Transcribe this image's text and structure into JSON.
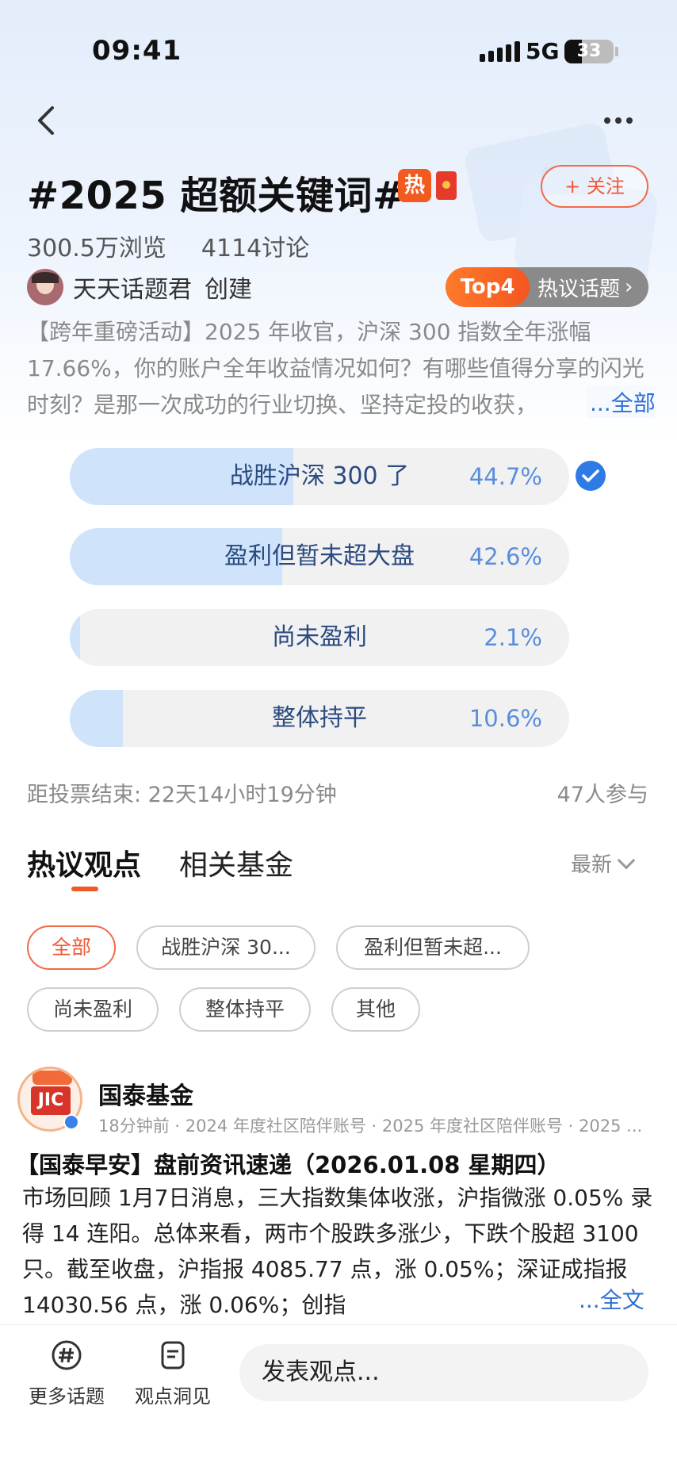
{
  "status_bar": {
    "time": "09:41",
    "network": "5G",
    "battery": "33"
  },
  "topic": {
    "title": "#2025 超额关键词#",
    "hot_badge": "热",
    "follow_label": "+ 关注",
    "views": "300.5万浏览",
    "discussions": "4114讨论",
    "creator_name": "天天话题君",
    "creator_action": "创建",
    "rank_label": "Top4",
    "rank_text": "热议话题",
    "rank_chevron": "›",
    "description": "【跨年重磅活动】2025 年收官，沪深 300 指数全年涨幅 17.66%，你的账户全年收益情况如何？有哪些值得分享的闪光时刻？是那一次成功的行业切换、坚持定投的收获，",
    "description_more": "...全部"
  },
  "poll": {
    "options": [
      {
        "label": "战胜沪深 300 了",
        "percent": "44.7%",
        "fill": 0.447,
        "selected": true
      },
      {
        "label": "盈利但暂未超大盘",
        "percent": "42.6%",
        "fill": 0.426,
        "selected": false
      },
      {
        "label": "尚未盈利",
        "percent": "2.1%",
        "fill": 0.021,
        "selected": false
      },
      {
        "label": "整体持平",
        "percent": "10.6%",
        "fill": 0.106,
        "selected": false
      }
    ],
    "countdown": "距投票结束:  22天14小时19分钟",
    "participants": "47人参与"
  },
  "tabs": {
    "active": "热议观点",
    "other": "相关基金",
    "sort": "最新"
  },
  "filters": [
    "全部",
    "战胜沪深 30...",
    "盈利但暂未超...",
    "尚未盈利",
    "整体持平",
    "其他"
  ],
  "post": {
    "author": "国泰基金",
    "avatar_text": "JIC",
    "meta": "18分钟前 · 2024 年度社区陪伴账号 · 2025 年度社区陪伴账号 · 2025 ...",
    "title": "【国泰早安】盘前资讯速递（2026.01.08 星期四）",
    "body": "市场回顾 1月7日消息，三大指数集体收涨，沪指微涨 0.05% 录得 14 连阳。总体来看，两市个股跌多涨少，下跌个股超 3100 只。截至收盘，沪指报 4085.77 点，涨 0.05%；深证成指报 14030.56 点，涨 0.06%；创指",
    "more": "...全文"
  },
  "bottom_bar": {
    "more_topics": "更多话题",
    "insights": "观点洞见",
    "input_placeholder": "发表观点..."
  },
  "colors": {
    "accent": "#f05a28",
    "link": "#2f6fd6",
    "poll_fill": "#cfe3fb",
    "check": "#2e7be6"
  }
}
